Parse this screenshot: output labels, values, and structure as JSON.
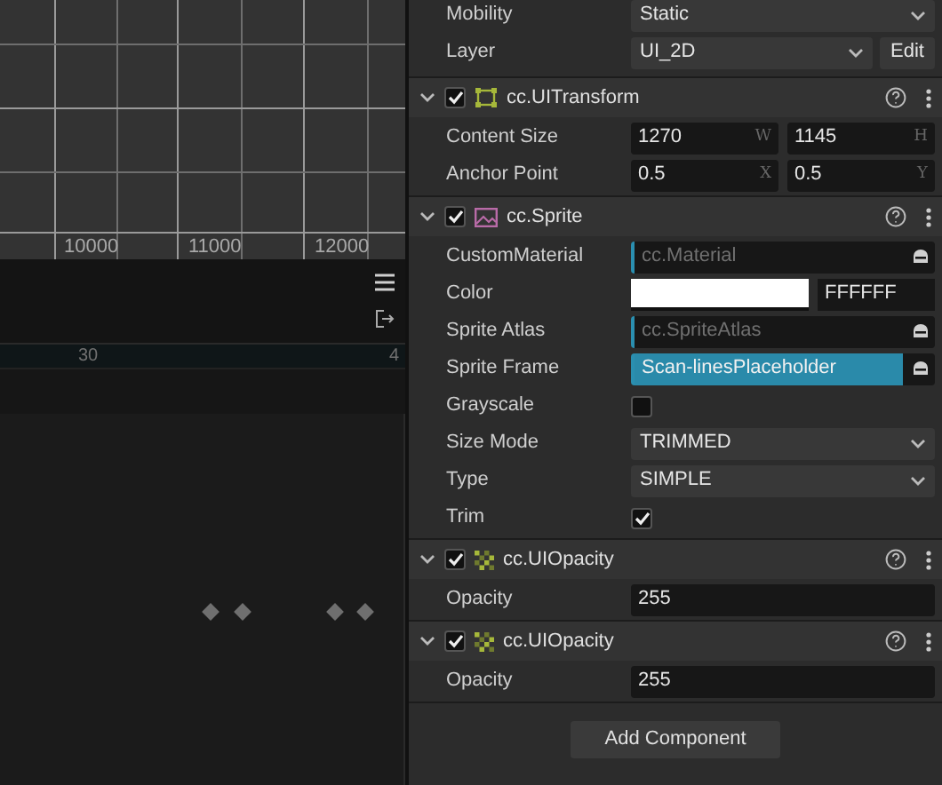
{
  "scene": {
    "ruler_labels": [
      "10000",
      "11000",
      "12000"
    ]
  },
  "timeline": {
    "ruler_labels": [
      "30",
      "4"
    ],
    "keyframes": [
      {
        "selected": false
      },
      {
        "selected": false
      },
      {
        "selected": false
      },
      {
        "selected": false
      }
    ]
  },
  "inspector": {
    "top_properties": [
      {
        "label": "Mobility",
        "value": "Static"
      },
      {
        "label": "Layer",
        "value": "UI_2D",
        "button": "Edit"
      }
    ],
    "components": [
      {
        "name": "cc.UITransform",
        "kind": "transform",
        "enabled": true,
        "expanded": true,
        "properties": [
          {
            "kind": "vector",
            "label": "Content Size",
            "fields": [
              {
                "value": "1270",
                "axis": "W"
              },
              {
                "value": "1145",
                "axis": "H"
              }
            ]
          },
          {
            "kind": "vector",
            "label": "Anchor Point",
            "fields": [
              {
                "value": "0.5",
                "axis": "X"
              },
              {
                "value": "0.5",
                "axis": "Y"
              }
            ]
          }
        ]
      },
      {
        "name": "cc.Sprite",
        "kind": "sprite",
        "enabled": true,
        "expanded": true,
        "properties": [
          {
            "kind": "asset",
            "label": "CustomMaterial",
            "placeholder": "cc.Material",
            "selected": false
          },
          {
            "kind": "color",
            "label": "Color",
            "color": "#ffffff",
            "hex": "FFFFFF"
          },
          {
            "kind": "asset",
            "label": "Sprite Atlas",
            "placeholder": "cc.SpriteAtlas",
            "selected": false
          },
          {
            "kind": "asset",
            "label": "Sprite Frame",
            "value": "Scan-linesPlaceholder",
            "selected": true
          },
          {
            "kind": "checkbox",
            "label": "Grayscale",
            "checked": false
          },
          {
            "kind": "select",
            "label": "Size Mode",
            "value": "TRIMMED"
          },
          {
            "kind": "select",
            "label": "Type",
            "value": "SIMPLE"
          },
          {
            "kind": "checkbox",
            "label": "Trim",
            "checked": true
          }
        ]
      },
      {
        "name": "cc.UIOpacity",
        "kind": "opacity",
        "enabled": true,
        "expanded": true,
        "properties": [
          {
            "kind": "number",
            "label": "Opacity",
            "value": "255"
          }
        ]
      },
      {
        "name": "cc.UIOpacity",
        "kind": "opacity",
        "enabled": true,
        "expanded": true,
        "properties": [
          {
            "kind": "number",
            "label": "Opacity",
            "value": "255"
          }
        ]
      }
    ],
    "add_button": "Add Component"
  }
}
